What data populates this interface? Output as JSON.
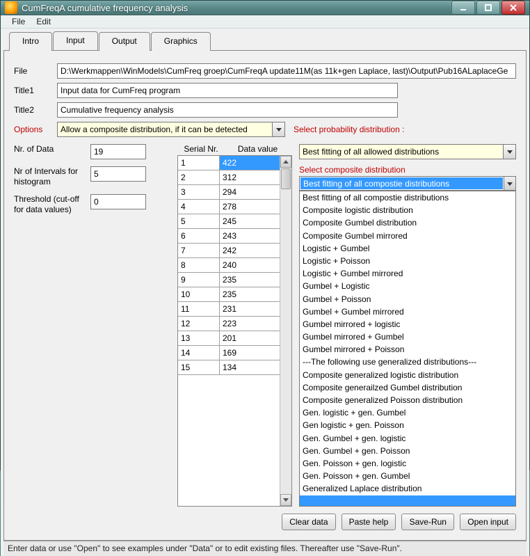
{
  "window": {
    "title": "CumFreqA cumulative frequency analysis"
  },
  "menu": {
    "file": "File",
    "edit": "Edit"
  },
  "tabs": {
    "intro": "Intro",
    "input": "Input",
    "output": "Output",
    "graphics": "Graphics"
  },
  "labels": {
    "file": "File",
    "title1": "Title1",
    "title2": "Title2",
    "options": "Options",
    "nr_data": "Nr. of Data",
    "nr_intervals": "Nr of Intervals for histogram",
    "threshold": "Threshold (cut-off for data values)",
    "serial": "Serial Nr.",
    "datavalue": "Data value",
    "select_prob": "Select probability distribution :",
    "select_comp": "Select composite distribution"
  },
  "fields": {
    "file": "D:\\Werkmappen\\WinModels\\CumFreq groep\\CumFreqA update11M(as 11k+gen Laplace, last)\\Output\\Pub16ALaplaceGe",
    "title1": "Input data for CumFreq program",
    "title2": "Cumulative frequency analysis",
    "options": "Allow a composite distribution, if it can be detected",
    "nr_data": "19",
    "nr_intervals": "5",
    "threshold": "0",
    "prob_dist": "Best fitting of all allowed distributions",
    "comp_dist": "Best fitting of all compostie distributions"
  },
  "grid": {
    "rows": [
      {
        "n": "1",
        "v": "422",
        "sel": true
      },
      {
        "n": "2",
        "v": "312"
      },
      {
        "n": "3",
        "v": "294"
      },
      {
        "n": "4",
        "v": "278"
      },
      {
        "n": "5",
        "v": "245"
      },
      {
        "n": "6",
        "v": "243"
      },
      {
        "n": "7",
        "v": "242"
      },
      {
        "n": "8",
        "v": "240"
      },
      {
        "n": "9",
        "v": "235"
      },
      {
        "n": "10",
        "v": "235"
      },
      {
        "n": "11",
        "v": "231"
      },
      {
        "n": "12",
        "v": "223"
      },
      {
        "n": "13",
        "v": "201"
      },
      {
        "n": "14",
        "v": "169"
      },
      {
        "n": "15",
        "v": "134"
      }
    ]
  },
  "composite_options": [
    "Best fitting of all compostie distributions",
    "Composite logistic distribution",
    "Composite Gumbel distribution",
    "Composite Gumbel mirrored",
    "Logistic + Gumbel",
    "Logistic + Poisson",
    "Logistic + Gumbel mirrored",
    "Gumbel + Logistic",
    "Gumbel + Poisson",
    "Gumbel + Gumbel mirrored",
    "Gumbel mirrored + logistic",
    "Gumbel mirrored + Gumbel",
    "Gumbel mirrored + Poisson",
    "---The following use generalized distributions---",
    "Composite generalized logistic distribution",
    "Composite generailzed Gumbel distribution",
    "Composite generalized Poisson distribution",
    "Gen. logistic + gen. Gumbel",
    "Gen logistic + gen. Poisson",
    "Gen. Gumbel + gen. logistic",
    "Gen. Gumbel + gen. Poisson",
    "Gen. Poisson + gen. logistic",
    "Gen. Poisson + gen. Gumbel",
    "Generalized Laplace distribution"
  ],
  "buttons": {
    "clear": "Clear data",
    "paste": "Paste help",
    "save": "Save-Run",
    "open": "Open input"
  },
  "status": "Enter data or use \"Open\" to see examples under \"Data\" or to edit existing files. Thereafter use \"Save-Run\"."
}
